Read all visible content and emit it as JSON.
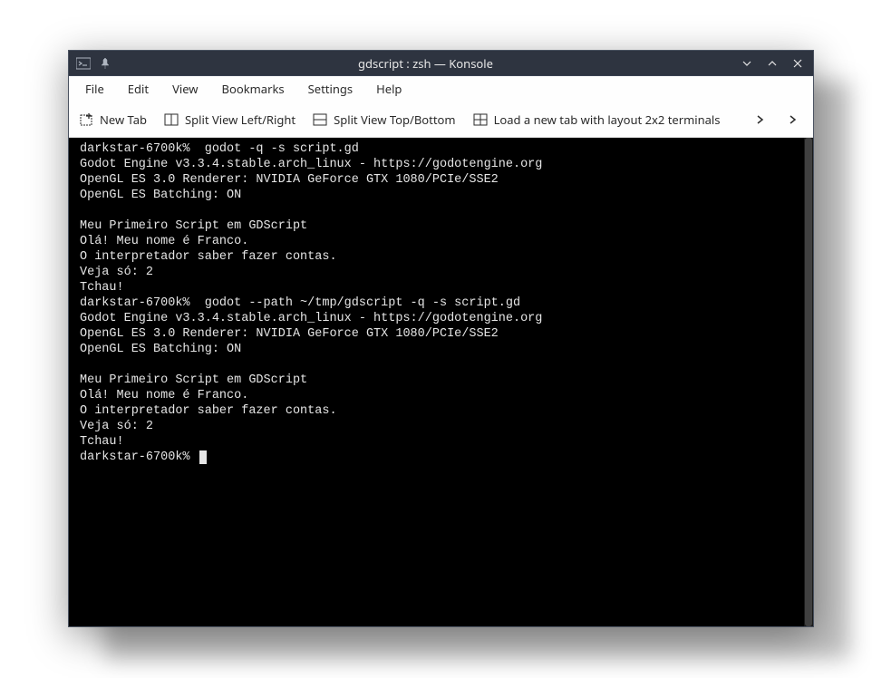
{
  "window": {
    "title": "gdscript : zsh — Konsole"
  },
  "menubar": {
    "items": [
      "File",
      "Edit",
      "View",
      "Bookmarks",
      "Settings",
      "Help"
    ]
  },
  "toolbar": {
    "newTab": "New Tab",
    "splitLR": "Split View Left/Right",
    "splitTB": "Split View Top/Bottom",
    "loadLayout": "Load a new tab with layout 2x2 terminals"
  },
  "terminal": {
    "lines": [
      "darkstar-6700k%  godot -q -s script.gd",
      "Godot Engine v3.3.4.stable.arch_linux - https://godotengine.org",
      "OpenGL ES 3.0 Renderer: NVIDIA GeForce GTX 1080/PCIe/SSE2",
      "OpenGL ES Batching: ON",
      " ",
      "Meu Primeiro Script em GDScript",
      "Olá! Meu nome é Franco.",
      "O interpretador saber fazer contas.",
      "Veja só: 2",
      "Tchau!",
      "darkstar-6700k%  godot --path ~/tmp/gdscript -q -s script.gd",
      "Godot Engine v3.3.4.stable.arch_linux - https://godotengine.org",
      "OpenGL ES 3.0 Renderer: NVIDIA GeForce GTX 1080/PCIe/SSE2",
      "OpenGL ES Batching: ON",
      " ",
      "Meu Primeiro Script em GDScript",
      "Olá! Meu nome é Franco.",
      "O interpretador saber fazer contas.",
      "Veja só: 2",
      "Tchau!"
    ],
    "lastPrompt": "darkstar-6700k% "
  }
}
